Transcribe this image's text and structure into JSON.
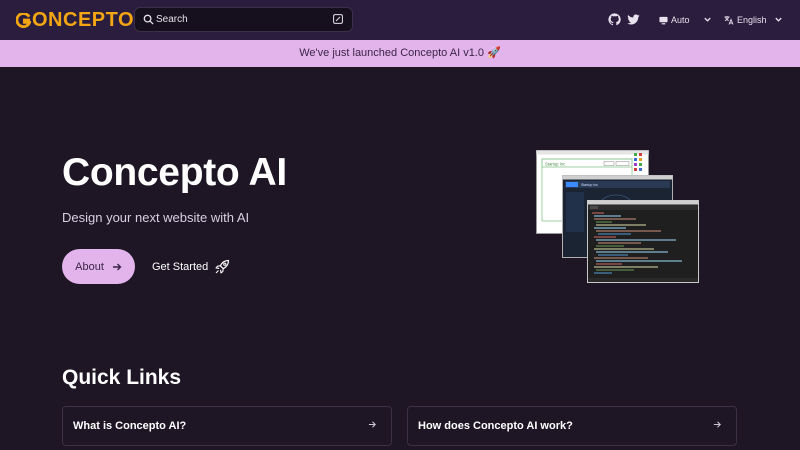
{
  "header": {
    "logo_text": "ONCEPTO",
    "search_placeholder": "Search",
    "theme_label": "Auto",
    "language_label": "English",
    "icons": [
      "github-icon",
      "twitter-icon",
      "display-icon",
      "translate-icon",
      "chevron-down-icon"
    ]
  },
  "announcement": {
    "text": "We've just launched Concepto AI v1.0 🚀"
  },
  "hero": {
    "title": "Concepto AI",
    "subtitle": "Design your next website with AI",
    "about_label": "About",
    "start_label": "Get Started",
    "mockup": {
      "window_title": "Startup Inc",
      "dark_window_title": "Startup Inc"
    }
  },
  "quick_links": {
    "title": "Quick Links",
    "items": [
      {
        "label": "What is Concepto AI?"
      },
      {
        "label": "How does Concepto AI work?"
      }
    ]
  },
  "colors": {
    "background": "#1e1625",
    "topbar": "#2b1d3e",
    "accent": "#e3b4ec",
    "logo": "#f3a613"
  }
}
